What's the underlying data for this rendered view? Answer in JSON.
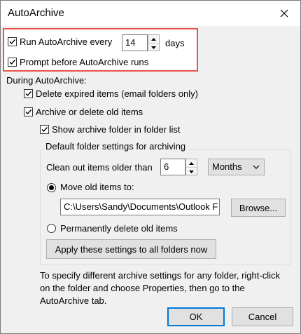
{
  "window": {
    "title": "AutoArchive"
  },
  "run_autoarchive": {
    "label": "Run AutoArchive every",
    "checked": true,
    "days_value": "14",
    "unit": "days"
  },
  "prompt_before": {
    "label": "Prompt before AutoArchive runs",
    "checked": true
  },
  "during_label": "During AutoArchive:",
  "delete_expired": {
    "label": "Delete expired items (email folders only)",
    "checked": true
  },
  "archive_old": {
    "label": "Archive or delete old items",
    "checked": true
  },
  "show_folder": {
    "label": "Show archive folder in folder list",
    "checked": true
  },
  "group": {
    "title": "Default folder settings for archiving",
    "clean_label": "Clean out items older than",
    "clean_value": "6",
    "clean_unit": "Months",
    "move_label": "Move old items to:",
    "move_path": "C:\\Users\\Sandy\\Documents\\Outlook F",
    "browse_label": "Browse...",
    "permanently_label": "Permanently delete old items",
    "apply_label": "Apply these settings to all folders now"
  },
  "info_text": "To specify different archive settings for any folder, right-click on the folder and choose Properties, then go to the AutoArchive tab.",
  "buttons": {
    "ok": "OK",
    "cancel": "Cancel"
  },
  "colors": {
    "highlight": "#e8534a",
    "default_button": "#0078d7"
  }
}
